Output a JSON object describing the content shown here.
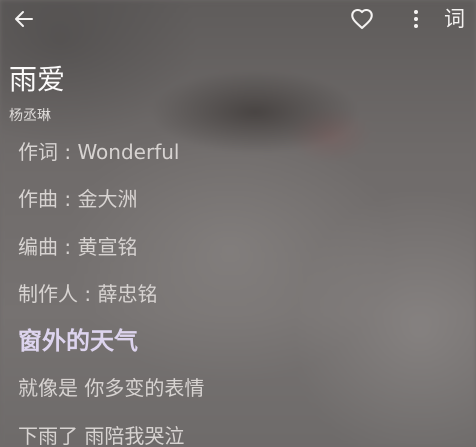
{
  "topbar": {
    "back_icon": "arrow-left-icon",
    "favorite_icon": "heart-outline-icon",
    "more_icon": "more-vertical-icon",
    "lyric_toggle_label": "词"
  },
  "song": {
    "title": "雨爱",
    "artist": "杨丞琳"
  },
  "lyrics": {
    "current_index": 4,
    "lines": [
      "作词 : Wonderful",
      "作曲 : 金大洲",
      "编曲 : 黄宣铭",
      "制作人 : 薛忠铭",
      "窗外的天气",
      "就像是 你多变的表情",
      "下雨了 雨陪我哭泣"
    ]
  },
  "colors": {
    "icon": "#f4f2f1",
    "title": "#fbfafa",
    "lyric_text": "#d7d3d1",
    "lyric_current": "#ddd4ee",
    "background": "#6e6b6a"
  }
}
